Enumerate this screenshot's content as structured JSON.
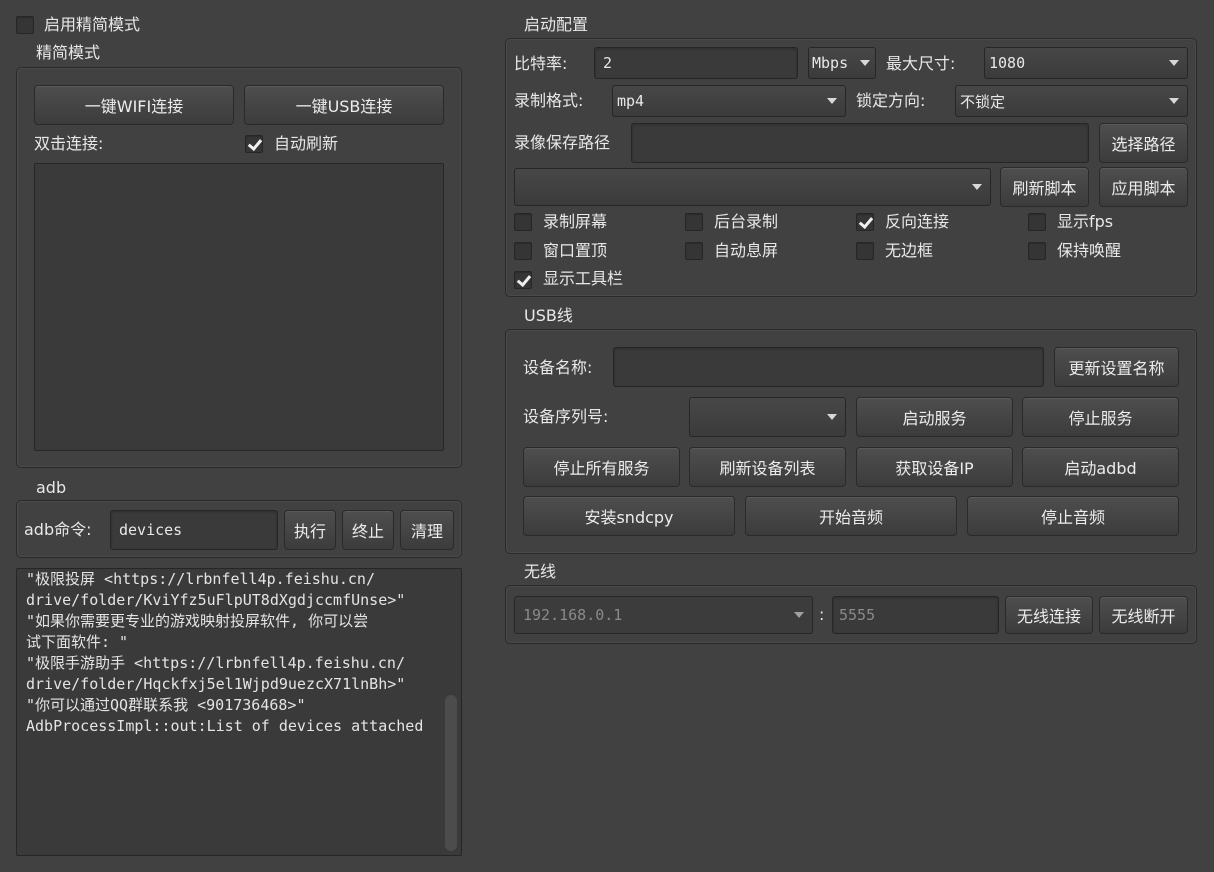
{
  "simple_mode_toggle": {
    "label": "启用精简模式",
    "checked": false
  },
  "simple_group": {
    "title": "精简模式",
    "wifi_button": "一键WIFI连接",
    "usb_button": "一键USB连接",
    "double_click_label": "双击连接:",
    "auto_refresh": {
      "label": "自动刷新",
      "checked": true
    }
  },
  "adb_group": {
    "title": "adb",
    "cmd_label": "adb命令:",
    "cmd_value": "devices",
    "exec_button": "执行",
    "stop_button": "终止",
    "clear_button": "清理"
  },
  "log": {
    "lines": [
      "\"极限投屏 <https://lrbnfell4p.feishu.cn/",
      "drive/folder/KviYfz5uFlpUT8dXgdjccmfUnse>\"",
      "",
      "\"如果你需要更专业的游戏映射投屏软件, 你可以尝",
      "试下面软件: \"",
      "",
      "\"极限手游助手 <https://lrbnfell4p.feishu.cn/",
      "drive/folder/Hqckfxj5el1Wjpd9uezcX71lnBh>\"",
      "",
      "\"你可以通过QQ群联系我 <901736468>\"",
      "",
      "AdbProcessImpl::out:List of devices attached"
    ]
  },
  "start_config": {
    "title": "启动配置",
    "bitrate_label": "比特率:",
    "bitrate_value": "2",
    "bitrate_unit": "Mbps",
    "max_size_label": "最大尺寸:",
    "max_size_value": "1080",
    "record_format_label": "录制格式:",
    "record_format_value": "mp4",
    "lock_orientation_label": "锁定方向:",
    "lock_orientation_value": "不锁定",
    "record_path_label": "录像保存路径",
    "record_path_value": "",
    "choose_path_button": "选择路径",
    "script_value": "",
    "refresh_script_button": "刷新脚本",
    "apply_script_button": "应用脚本",
    "options": {
      "record_screen": {
        "label": "录制屏幕",
        "checked": false
      },
      "background_record": {
        "label": "后台录制",
        "checked": false
      },
      "reverse_connect": {
        "label": "反向连接",
        "checked": true
      },
      "show_fps": {
        "label": "显示fps",
        "checked": false
      },
      "window_on_top": {
        "label": "窗口置顶",
        "checked": false
      },
      "auto_screen_off": {
        "label": "自动息屏",
        "checked": false
      },
      "frameless": {
        "label": "无边框",
        "checked": false
      },
      "stay_awake": {
        "label": "保持唤醒",
        "checked": false
      },
      "show_toolbar": {
        "label": "显示工具栏",
        "checked": true
      }
    }
  },
  "usb_group": {
    "title": "USB线",
    "device_name_label": "设备名称:",
    "device_name_value": "",
    "update_name_button": "更新设置名称",
    "serial_label": "设备序列号:",
    "serial_value": "",
    "start_service_button": "启动服务",
    "stop_service_button": "停止服务",
    "stop_all_button": "停止所有服务",
    "refresh_devices_button": "刷新设备列表",
    "get_ip_button": "获取设备IP",
    "start_adbd_button": "启动adbd",
    "install_sndcpy_button": "安装sndcpy",
    "start_audio_button": "开始音频",
    "stop_audio_button": "停止音频"
  },
  "wireless_group": {
    "title": "无线",
    "ip_value": "192.168.0.1",
    "separator": ":",
    "port_value": "5555",
    "connect_button": "无线连接",
    "disconnect_button": "无线断开"
  }
}
